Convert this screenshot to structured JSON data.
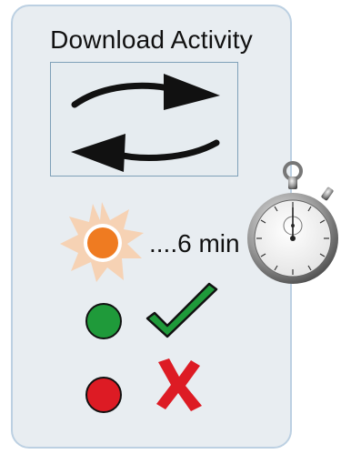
{
  "card": {
    "title": "Download Activity"
  },
  "sync": {
    "icon": "sync-arrows-icon"
  },
  "status": {
    "loading_icon": "sun-burst-icon",
    "duration_text": "....6 min",
    "timer_icon": "stopwatch-icon",
    "success_dot": "green-dot-icon",
    "success_icon": "checkmark-icon",
    "failure_dot": "red-dot-icon",
    "failure_icon": "cross-icon"
  },
  "colors": {
    "card_background": "#e8edf1",
    "card_border": "#bcd0e2",
    "sun_orange": "#ef7b21",
    "sun_rays": "#f6d2b4",
    "success_green": "#1f9a3a",
    "failure_red": "#dd1b24"
  }
}
